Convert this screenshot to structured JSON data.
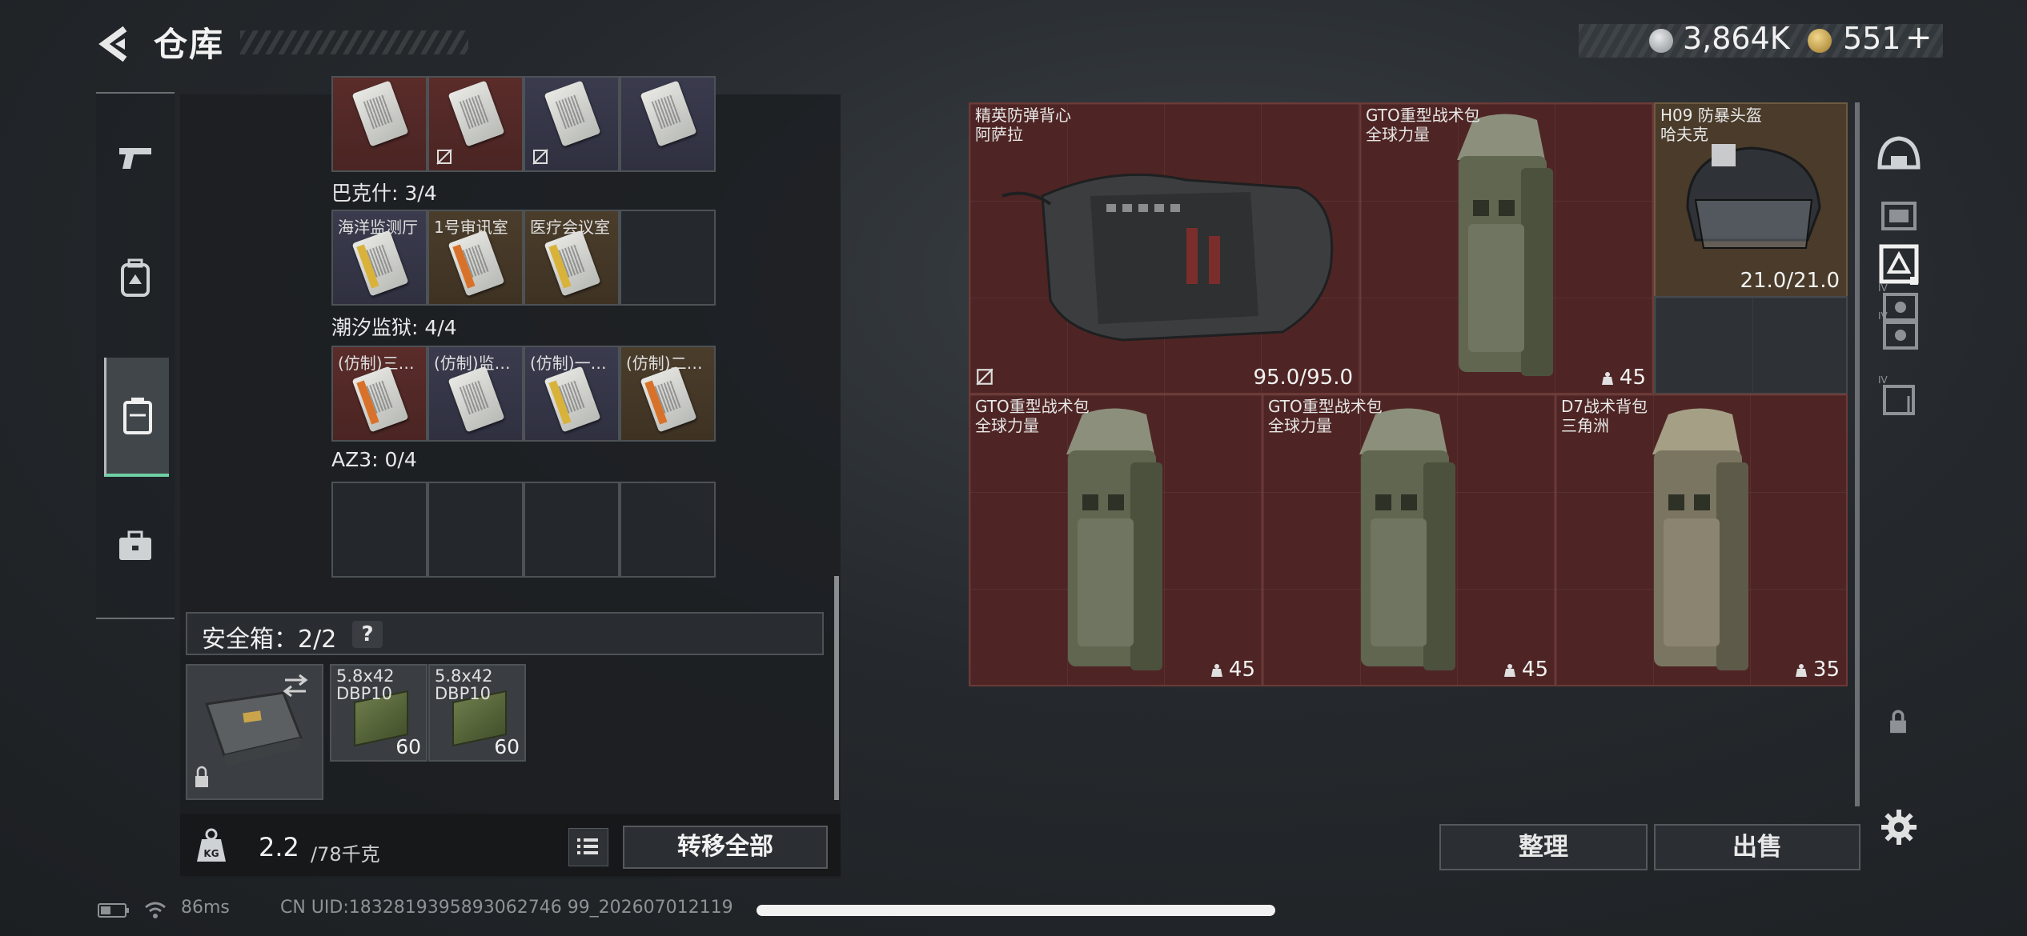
{
  "header": {
    "title": "仓库",
    "currency_silver": "3,864K",
    "currency_gold": "551",
    "currency_add": "+"
  },
  "left_nav": [
    "pistol-icon",
    "backpack-icon",
    "container-icon",
    "toolbox-icon"
  ],
  "left_panel": {
    "top_row": [
      "",
      "",
      "",
      ""
    ],
    "section1_label": "巴克什: 3/4",
    "section1_items": [
      "海洋监测厅",
      "1号审讯室",
      "医疗会议室",
      ""
    ],
    "section2_label": "潮汐监狱: 4/4",
    "section2_items": [
      "(仿制)三…",
      "(仿制)监…",
      "(仿制)一…",
      "(仿制)二…"
    ],
    "section3_label": "AZ3: 0/4",
    "safebox_label": "安全箱：2/2",
    "safebox_help": "?",
    "ammo": [
      {
        "name": "5.8x42",
        "sub": "DBP10",
        "count": "60"
      },
      {
        "name": "5.8x42",
        "sub": "DBP10",
        "count": "60"
      }
    ],
    "weight_current": "2.2",
    "weight_max": "/78千克",
    "transfer_all": "转移全部"
  },
  "right_panel": {
    "items": [
      {
        "name": "精英防弹背心",
        "sub": "阿萨拉",
        "value": "95.0/95.0"
      },
      {
        "name": "GTO重型战术包",
        "sub": "全球力量",
        "value": "45"
      },
      {
        "name": "H09 防暴头盔",
        "sub": "哈夫克",
        "value": "21.0/21.0"
      },
      {
        "name": "GTO重型战术包",
        "sub": "全球力量",
        "value": "45"
      },
      {
        "name": "GTO重型战术包",
        "sub": "全球力量",
        "value": "45"
      },
      {
        "name": "D7战术背包",
        "sub": "三角洲",
        "value": "35"
      }
    ],
    "sort_label": "整理",
    "sell_label": "出售"
  },
  "right_nav": [
    "helmet-slot-icon",
    "armor-slot-icon",
    "chest-rig-slot-icon",
    "backpack-slot-icon",
    "case-slot-icon",
    "pouch-slot-icon",
    "lock-icon",
    "settings-gear-icon"
  ],
  "status": {
    "ping": "86ms",
    "uid": "CN UID:1832819395893062746 99_202607012119"
  },
  "colors": {
    "accent_green": "#6fd0a5",
    "red_rarity": "#4e2524",
    "gold_rarity": "#4a3b2a",
    "blue_rarity": "#3a3b4d"
  }
}
